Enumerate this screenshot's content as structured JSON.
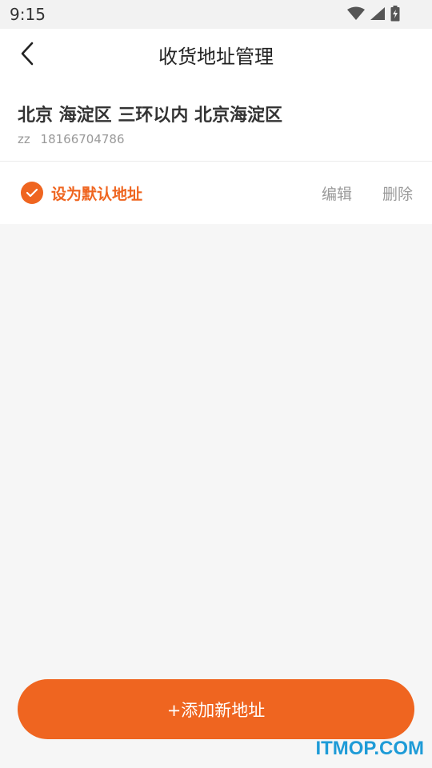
{
  "status_bar": {
    "time": "9:15"
  },
  "nav": {
    "title": "收货地址管理"
  },
  "address": {
    "full_text": "北京 海淀区 三环以内  北京海淀区",
    "name": "zz",
    "phone": "18166704786"
  },
  "actions": {
    "default_label": "设为默认地址",
    "edit_label": "编辑",
    "delete_label": "删除"
  },
  "footer": {
    "add_label": "+添加新地址"
  },
  "watermark": {
    "text": "ITMOP.COM"
  },
  "colors": {
    "accent": "#ef6520",
    "watermark": "#1e9bd7"
  },
  "icons": [
    "wifi-icon",
    "signal-icon",
    "battery-icon",
    "back-arrow-icon",
    "check-icon"
  ]
}
